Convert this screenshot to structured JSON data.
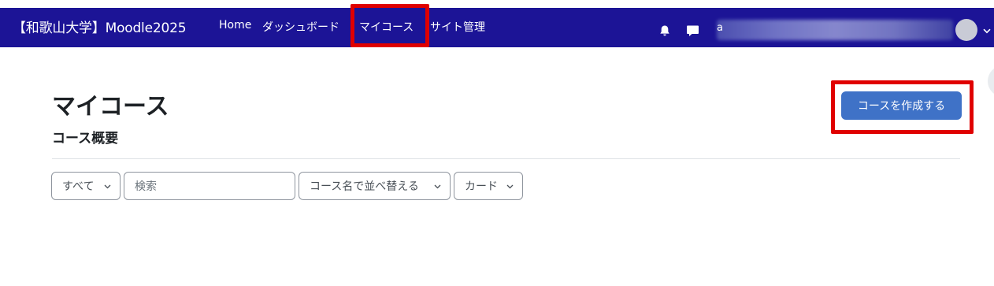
{
  "header": {
    "brand": "【和歌山大学】Moodle2025",
    "nav": {
      "home": "Home",
      "dashboard": "ダッシュボード",
      "my_courses": "マイコース",
      "site_admin": "サイト管理"
    },
    "icons": {
      "notifications": "bell-icon",
      "messages": "chat-icon",
      "user_menu": "chevron-down-icon"
    },
    "user_name_visible_initial": "a",
    "bar_color": "#1c1496"
  },
  "main": {
    "page_title": "マイコース",
    "section_title": "コース概要",
    "create_course_label": "コースを作成する",
    "accent_color": "#3f72c7"
  },
  "filters": {
    "grouping_selected": "すべて",
    "search_placeholder": "検索",
    "sort_selected": "コース名で並べ替える",
    "view_selected": "カード"
  },
  "annotations": {
    "highlight_color": "#e00000"
  }
}
